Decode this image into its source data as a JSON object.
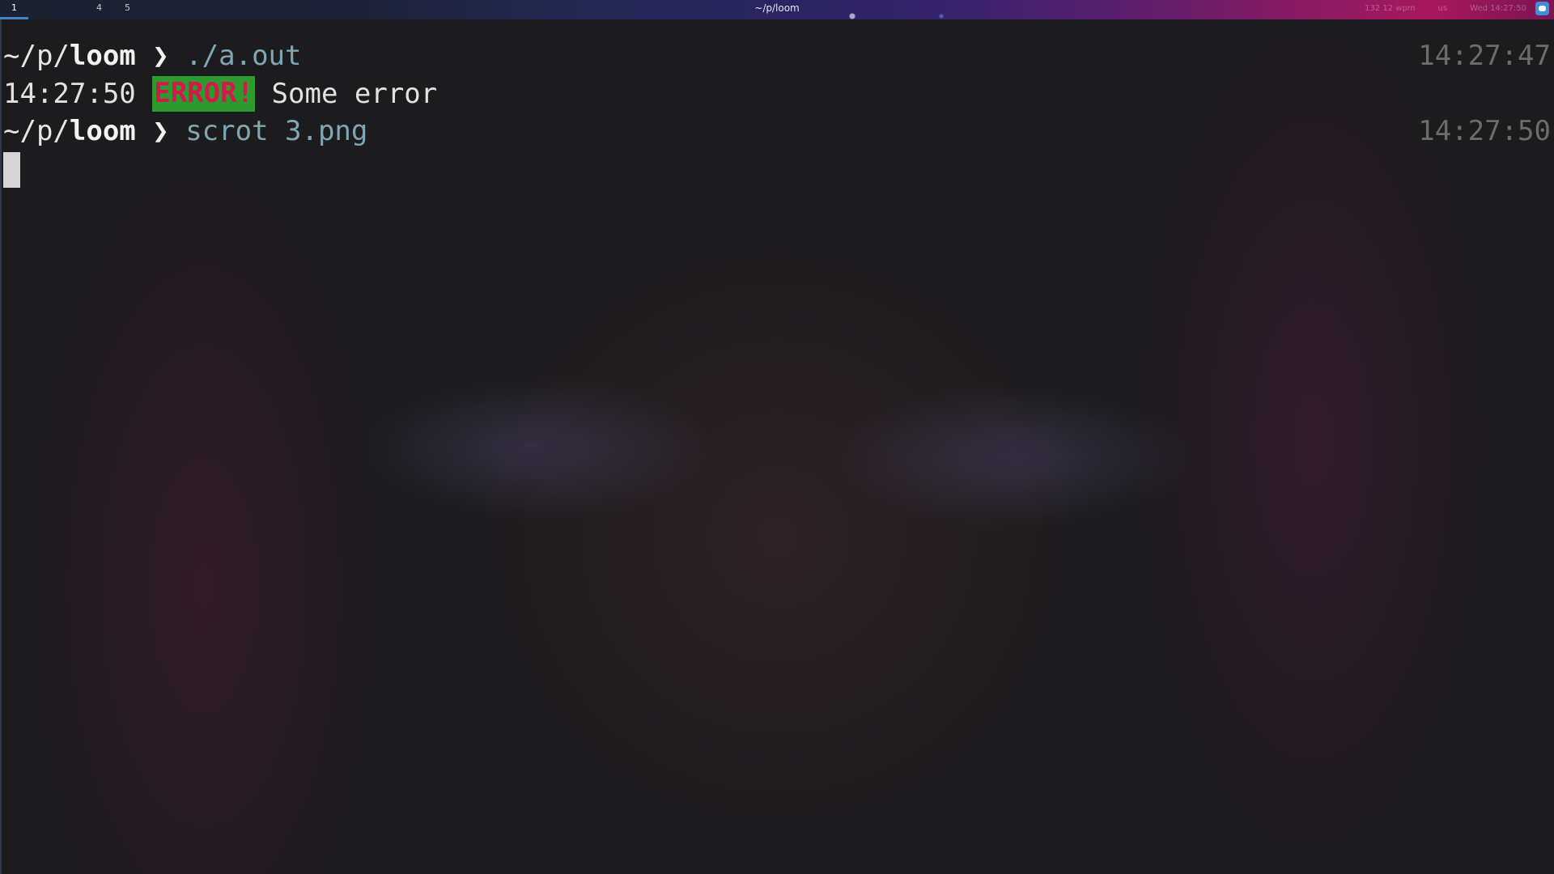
{
  "topbar": {
    "workspaces": [
      "1",
      "",
      "",
      "4",
      "5"
    ],
    "active_workspace": "1",
    "window_title": "~/p/loom",
    "status": {
      "item1": "132  12 wpm",
      "item2": "us",
      "item3": "Wed 14:27:50"
    },
    "tray_icon": "discord-icon"
  },
  "terminal": {
    "line1": {
      "path_prefix": "~/p/",
      "path_dir": "loom",
      "arrow": " ❯ ",
      "command": "./a.out",
      "timestamp": "14:27:47"
    },
    "line2": {
      "time": "14:27:50 ",
      "badge": "ERROR!",
      "message": " Some error"
    },
    "line3": {
      "path_prefix": "~/p/",
      "path_dir": "loom",
      "arrow": " ❯ ",
      "command": "scrot 3.png",
      "timestamp": "14:27:50"
    }
  },
  "colors": {
    "command": "#7fa7b3",
    "error_badge_bg": "#2c9a2f",
    "error_badge_fg": "#d4184c",
    "timestamp": "#6c6c6c",
    "active_workspace_underline": "#3f84c6"
  }
}
